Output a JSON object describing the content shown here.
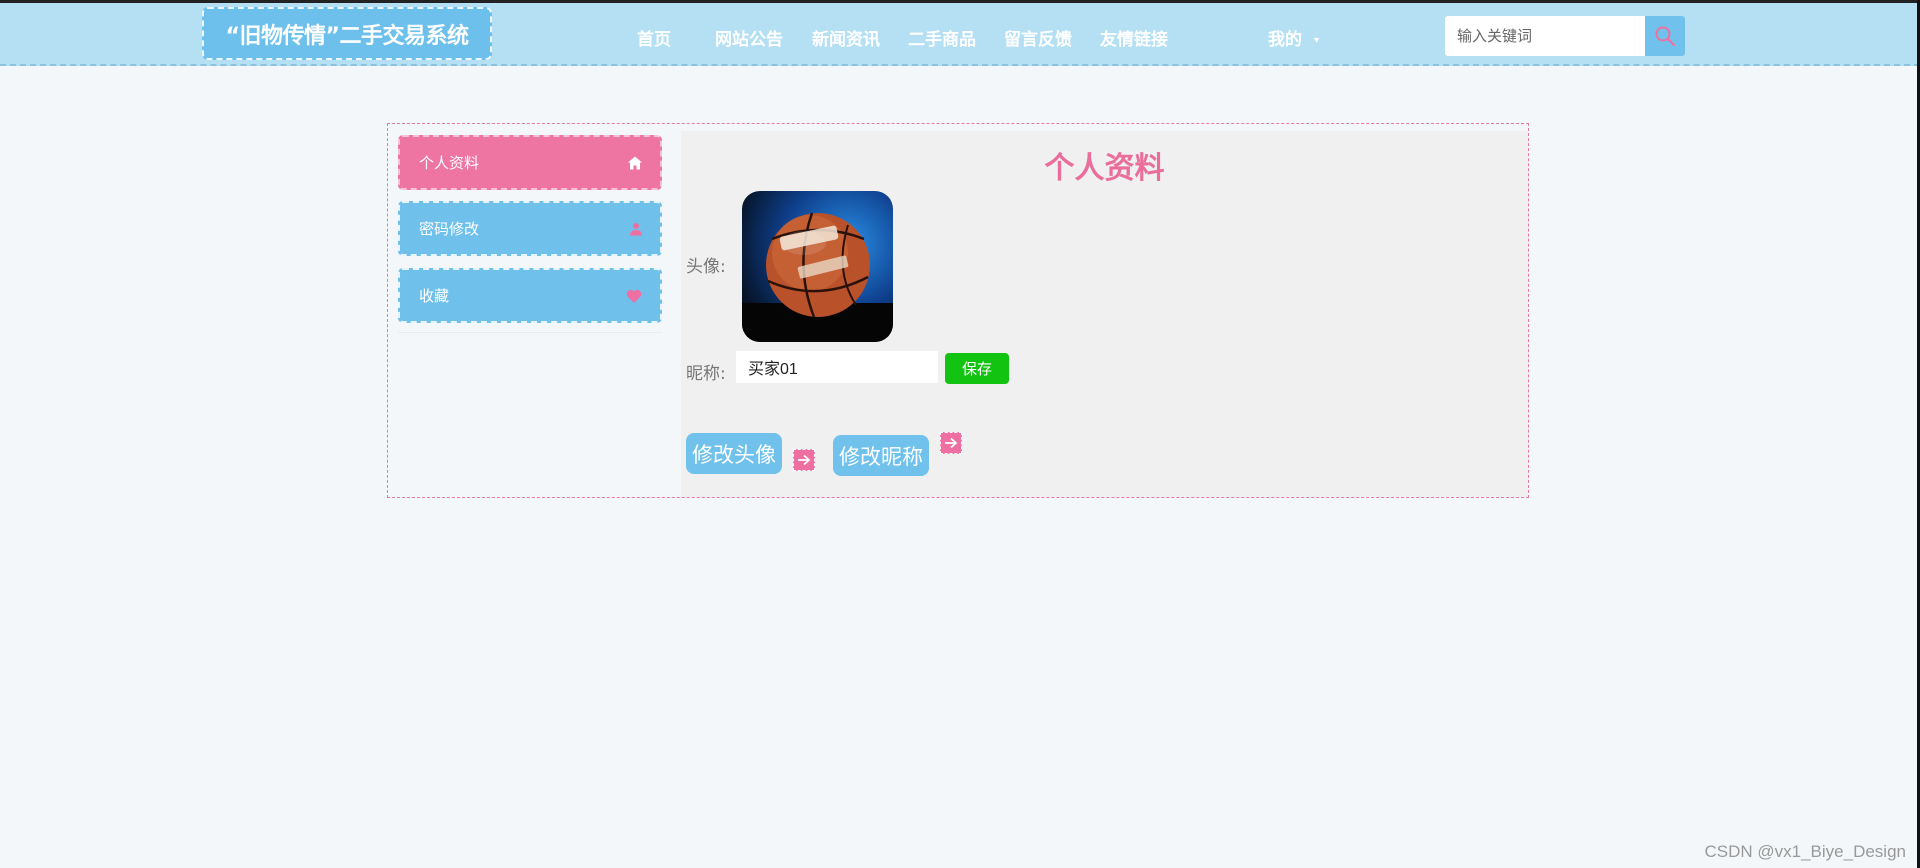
{
  "header": {
    "brand": "“旧物传情”二手交易系统",
    "nav": [
      "首页",
      "网站公告",
      "新闻资讯",
      "二手商品",
      "留言反馈",
      "友情链接"
    ],
    "mine": "我的",
    "search_placeholder": "输入关键词"
  },
  "sidebar": {
    "items": [
      {
        "label": "个人资料",
        "icon": "home-icon",
        "active": true
      },
      {
        "label": "密码修改",
        "icon": "user-icon",
        "active": false
      },
      {
        "label": "收藏",
        "icon": "heart-icon",
        "active": false
      }
    ]
  },
  "profile": {
    "title": "个人资料",
    "avatar_label": "头像:",
    "nickname_label": "昵称:",
    "nickname_value": "买家01",
    "save_label": "保存",
    "change_avatar_label": "修改头像",
    "change_nickname_label": "修改昵称"
  },
  "footer": {
    "watermark": "CSDN @vx1_Biye_Design"
  },
  "colors": {
    "header_bg": "#b5dff3",
    "accent_pink": "#ee75a2",
    "accent_blue": "#70c0ec",
    "save_green": "#12c312"
  }
}
